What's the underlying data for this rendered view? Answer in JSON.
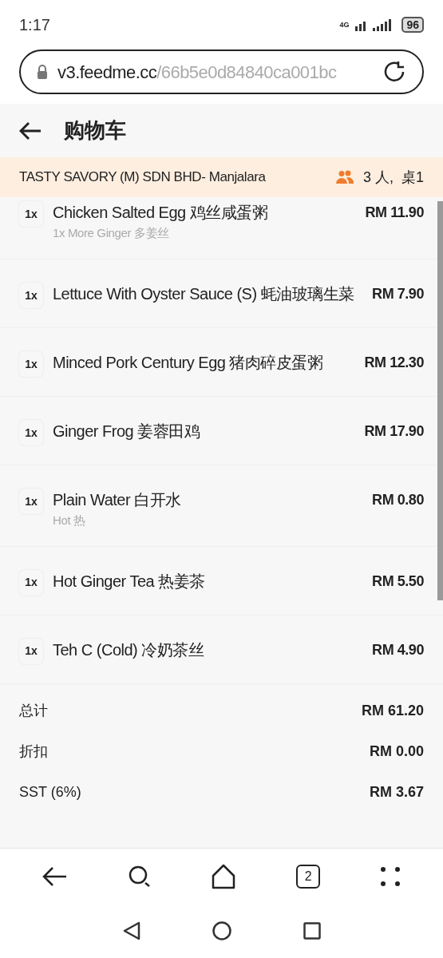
{
  "status_bar": {
    "time": "1:17",
    "network": "4G",
    "battery": "96"
  },
  "url_bar": {
    "domain": "v3.feedme.cc",
    "path": "/66b5e0d84840ca001bc"
  },
  "header": {
    "title": "购物车"
  },
  "banner": {
    "store": "TASTY SAVORY (M) SDN BHD- Manjalara",
    "party": "3 人,  桌1"
  },
  "items": [
    {
      "qty": "1x",
      "name": "Chicken Salted Egg 鸡丝咸蛋粥",
      "note": "1x More Ginger 多姜丝",
      "price": "RM 11.90"
    },
    {
      "qty": "1x",
      "name": "Lettuce With Oyster Sauce (S) 蚝油玻璃生菜",
      "price": "RM 7.90"
    },
    {
      "qty": "1x",
      "name": "Minced Pork Century Egg 猪肉碎皮蛋粥",
      "price": "RM 12.30"
    },
    {
      "qty": "1x",
      "name": "Ginger Frog 姜蓉田鸡",
      "price": "RM 17.90"
    },
    {
      "qty": "1x",
      "name": "Plain Water 白开水",
      "note": "Hot 热",
      "price": "RM 0.80"
    },
    {
      "qty": "1x",
      "name": "Hot Ginger Tea 热姜茶",
      "price": "RM 5.50"
    },
    {
      "qty": "1x",
      "name": "Teh C (Cold) 冷奶茶丝",
      "price": "RM 4.90"
    }
  ],
  "summary": [
    {
      "label": "总计",
      "value": "RM 61.20"
    },
    {
      "label": "折扣",
      "value": "RM 0.00"
    },
    {
      "label": "SST (6%)",
      "value": "RM 3.67"
    }
  ],
  "browser_toolbar": {
    "tab_count": "2"
  }
}
